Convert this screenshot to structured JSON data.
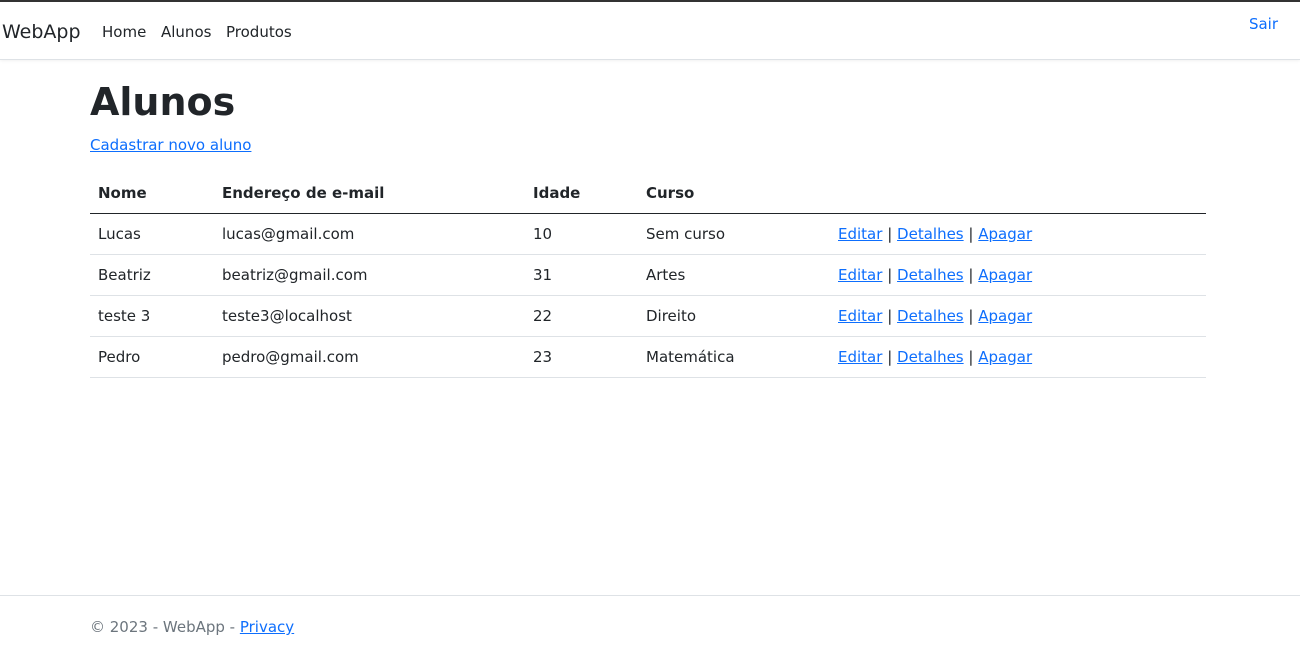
{
  "navbar": {
    "brand": "WebApp",
    "links": [
      {
        "label": "Home"
      },
      {
        "label": "Alunos"
      },
      {
        "label": "Produtos"
      }
    ],
    "logout": "Sair"
  },
  "main": {
    "title": "Alunos",
    "create_link": "Cadastrar novo aluno",
    "table": {
      "headers": [
        "Nome",
        "Endereço de e-mail",
        "Idade",
        "Curso",
        ""
      ],
      "rows": [
        {
          "nome": "Lucas",
          "email": "lucas@gmail.com",
          "idade": "10",
          "curso": "Sem curso"
        },
        {
          "nome": "Beatriz",
          "email": "beatriz@gmail.com",
          "idade": "31",
          "curso": "Artes"
        },
        {
          "nome": "teste 3",
          "email": "teste3@localhost",
          "idade": "22",
          "curso": "Direito"
        },
        {
          "nome": "Pedro",
          "email": "pedro@gmail.com",
          "idade": "23",
          "curso": "Matemática"
        }
      ],
      "actions": {
        "edit": "Editar",
        "details": "Detalhes",
        "delete": "Apagar",
        "separator": "|"
      }
    }
  },
  "footer": {
    "text": "© 2023 - WebApp - ",
    "privacy": "Privacy"
  },
  "colors": {
    "link": "#0d6efd",
    "text": "#212529",
    "muted": "#6c757d",
    "border": "#dee2e6"
  }
}
